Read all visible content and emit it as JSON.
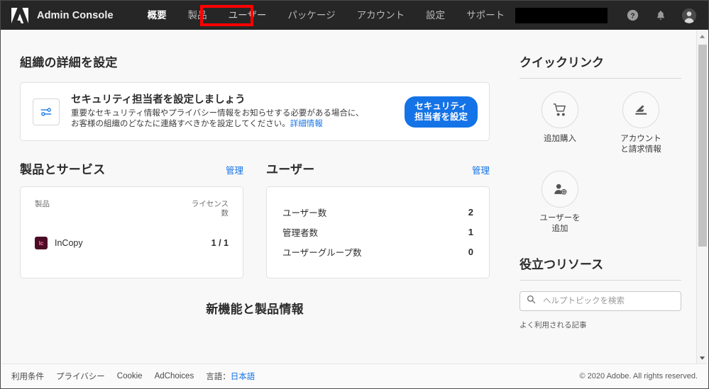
{
  "header": {
    "brand": "Admin Console",
    "logo_icon": "adobe-logo",
    "nav": [
      {
        "label": "概要",
        "state": "active"
      },
      {
        "label": "製品",
        "state": "normal"
      },
      {
        "label": "ユーザー",
        "state": "highlighted"
      },
      {
        "label": "パッケージ",
        "state": "normal"
      },
      {
        "label": "アカウント",
        "state": "normal"
      },
      {
        "label": "設定",
        "state": "normal"
      },
      {
        "label": "サポート",
        "state": "normal"
      }
    ],
    "icons": [
      "help-icon",
      "notifications-bell-icon",
      "user-avatar-icon"
    ],
    "highlight_color": "#ff0000"
  },
  "main": {
    "org_section_title": "組織の詳細を設定",
    "security_card": {
      "icon": "settings-sliders-icon",
      "title": "セキュリティ担当者を設定しましょう",
      "body_line1": "重要なセキュリティ情報やプライバシー情報をお知らせする必要がある場合に、",
      "body_line2": "お客様の組織のどなたに連絡すべきかを設定してください。",
      "body_link": "詳細情報",
      "button_line1": "セキュリティ",
      "button_line2": "担当者を設定",
      "button_color": "#1473e6"
    },
    "products": {
      "title": "製品とサービス",
      "manage_label": "管理",
      "col_product": "製品",
      "col_licenses": "ライセンス数",
      "rows": [
        {
          "icon_text": "Ic",
          "name": "InCopy",
          "licenses": "1 / 1",
          "icon_color": "#4c0c25"
        }
      ]
    },
    "users": {
      "title": "ユーザー",
      "manage_label": "管理",
      "stats": [
        {
          "label": "ユーザー数",
          "value": "2"
        },
        {
          "label": "管理者数",
          "value": "1"
        },
        {
          "label": "ユーザーグループ数",
          "value": "0"
        }
      ]
    },
    "news_title": "新機能と製品情報"
  },
  "sidebar": {
    "quicklinks_title": "クイックリンク",
    "quicklinks": [
      {
        "label": "追加購入",
        "icon": "shopping-cart-icon"
      },
      {
        "label": "アカウント\nと請求情報",
        "icon": "billing-card-icon"
      },
      {
        "label": "ユーザーを\n追加",
        "icon": "add-user-icon"
      }
    ],
    "resources_title": "役立つリソース",
    "search_placeholder": "ヘルプトピックを検索",
    "search_value": "",
    "search_icon": "search-icon",
    "resources_footer": "よく利用される記事"
  },
  "footer": {
    "links": [
      "利用条件",
      "プライバシー",
      "Cookie",
      "AdChoices"
    ],
    "language_label": "言語：",
    "language_value": "日本語",
    "copyright": "© 2020 Adobe. All rights reserved."
  }
}
